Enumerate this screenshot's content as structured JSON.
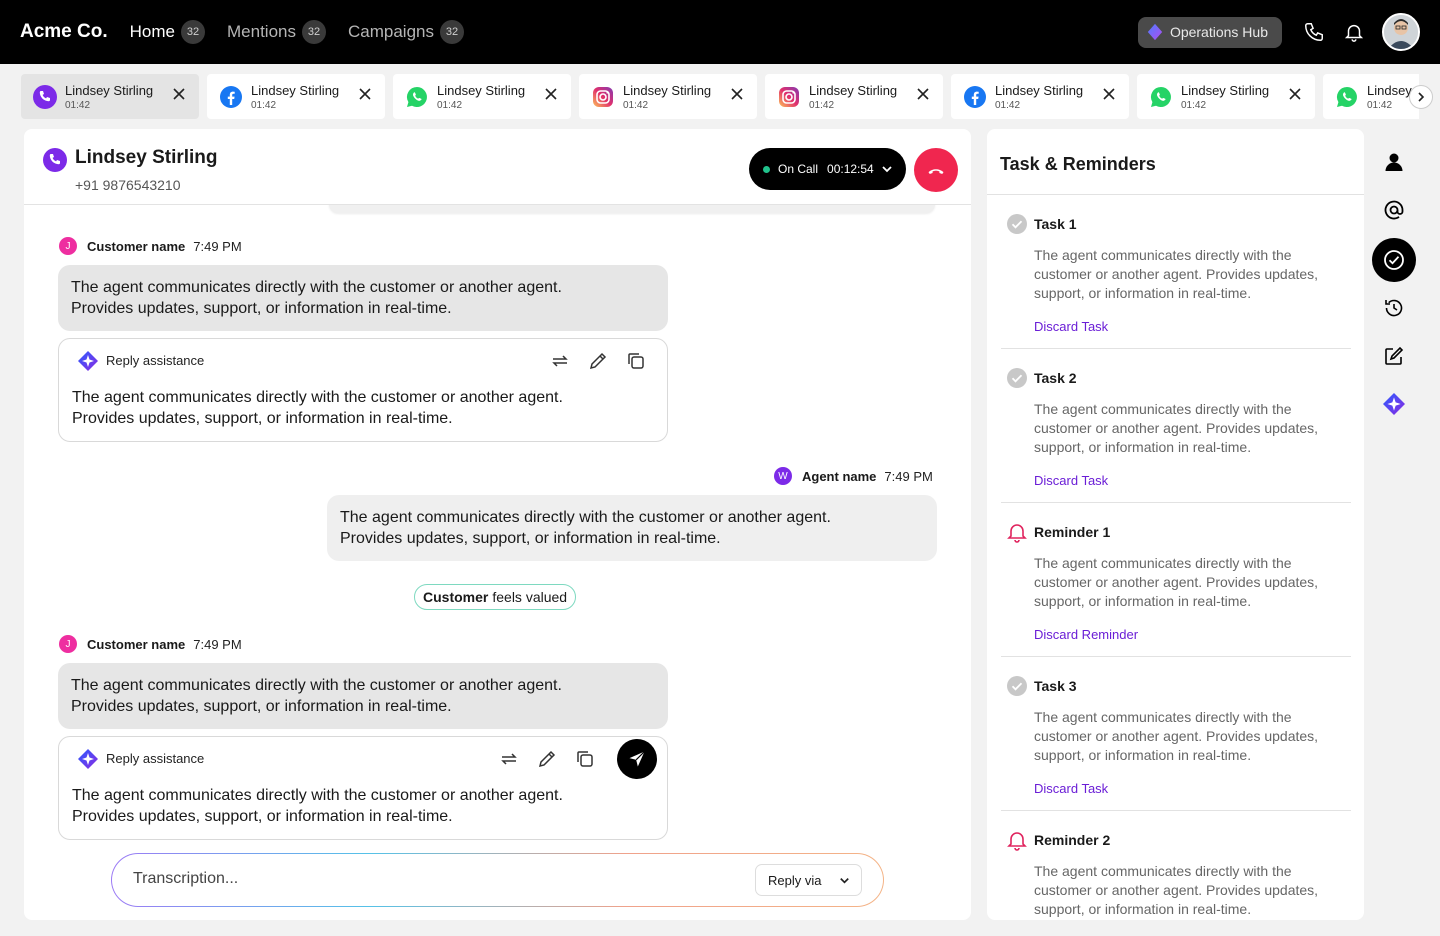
{
  "app": {
    "brand": "Acme Co.",
    "nav": [
      {
        "label": "Home",
        "count": "32"
      },
      {
        "label": "Mentions",
        "count": "32"
      },
      {
        "label": "Campaigns",
        "count": "32"
      }
    ],
    "ops_hub_label": "Operations Hub",
    "icons": [
      "phone-icon",
      "bell-icon",
      "avatar"
    ]
  },
  "tabs": [
    {
      "name": "Lindsey Stirling",
      "time": "01:42",
      "channel": "phone"
    },
    {
      "name": "Lindsey Stirling",
      "time": "01:42",
      "channel": "facebook"
    },
    {
      "name": "Lindsey Stirling",
      "time": "01:42",
      "channel": "whatsapp"
    },
    {
      "name": "Lindsey Stirling",
      "time": "01:42",
      "channel": "instagram"
    },
    {
      "name": "Lindsey Stirling",
      "time": "01:42",
      "channel": "instagram"
    },
    {
      "name": "Lindsey Stirling",
      "time": "01:42",
      "channel": "facebook"
    },
    {
      "name": "Lindsey Stirling",
      "time": "01:42",
      "channel": "whatsapp"
    },
    {
      "name": "Lindsey Stirling",
      "time": "01:42",
      "channel": "whatsapp"
    }
  ],
  "conversation": {
    "contact_name": "Lindsey Stirling",
    "contact_phone": "+91 9876543210",
    "call_status": "On Call",
    "call_timer": "00:12:54",
    "messages": [
      {
        "author": "Customer name",
        "initial": "J",
        "time": "7:49 PM",
        "text_line1": "The agent communicates directly with the customer or another agent.",
        "text_line2": "Provides updates, support, or information in real-time."
      },
      {
        "author": "Agent name",
        "initial": "W",
        "time": "7:49 PM",
        "text_line1": "The agent communicates directly with the customer or another agent.",
        "text_line2": "Provides updates, support, or information in real-time."
      },
      {
        "author": "Customer name",
        "initial": "J",
        "time": "7:49 PM",
        "text_line1": "The agent communicates directly with the customer or another agent.",
        "text_line2": "Provides updates, support, or information in real-time."
      }
    ],
    "reply_assist": [
      {
        "title": "Reply assistance",
        "text_line1": "The agent communicates directly with the customer or another agent.",
        "text_line2": "Provides updates, support, or information in real-time."
      },
      {
        "title": "Reply assistance",
        "text_line1": "The agent communicates directly with the customer or another agent.",
        "text_line2": "Provides updates, support, or information in real-time."
      }
    ],
    "sentiment": {
      "bold": "Customer",
      "rest": "feels valued"
    },
    "composer_placeholder": "Transcription...",
    "reply_via_label": "Reply via"
  },
  "tasks": {
    "title": "Task & Reminders",
    "items": [
      {
        "kind": "task",
        "title": "Task 1",
        "desc": "The agent communicates directly with the customer or another agent. Provides updates, support, or information in real-time.",
        "action": "Discard Task"
      },
      {
        "kind": "task",
        "title": "Task 2",
        "desc": "The agent communicates directly with the customer or another agent. Provides updates, support, or information in real-time.",
        "action": "Discard Task"
      },
      {
        "kind": "reminder",
        "title": "Reminder 1",
        "desc": "The agent communicates directly with the customer or another agent. Provides updates, support, or information in real-time.",
        "action": "Discard Reminder"
      },
      {
        "kind": "task",
        "title": "Task 3",
        "desc": "The agent communicates directly with the customer or another agent. Provides updates, support, or information in real-time.",
        "action": "Discard Task"
      },
      {
        "kind": "reminder",
        "title": "Reminder 2",
        "desc": "The agent communicates directly with the customer or another agent. Provides updates, support, or information in real-time.",
        "action": "Discard Reminder"
      }
    ]
  },
  "rail": [
    "contact-icon",
    "mention-icon",
    "task-check-icon",
    "history-icon",
    "edit-icon",
    "ai-sparkle-icon"
  ],
  "colors": {
    "accent": "#6a1dd6",
    "hangup": "#f0264f",
    "online": "#21c28c",
    "reminder": "#e0245e"
  }
}
